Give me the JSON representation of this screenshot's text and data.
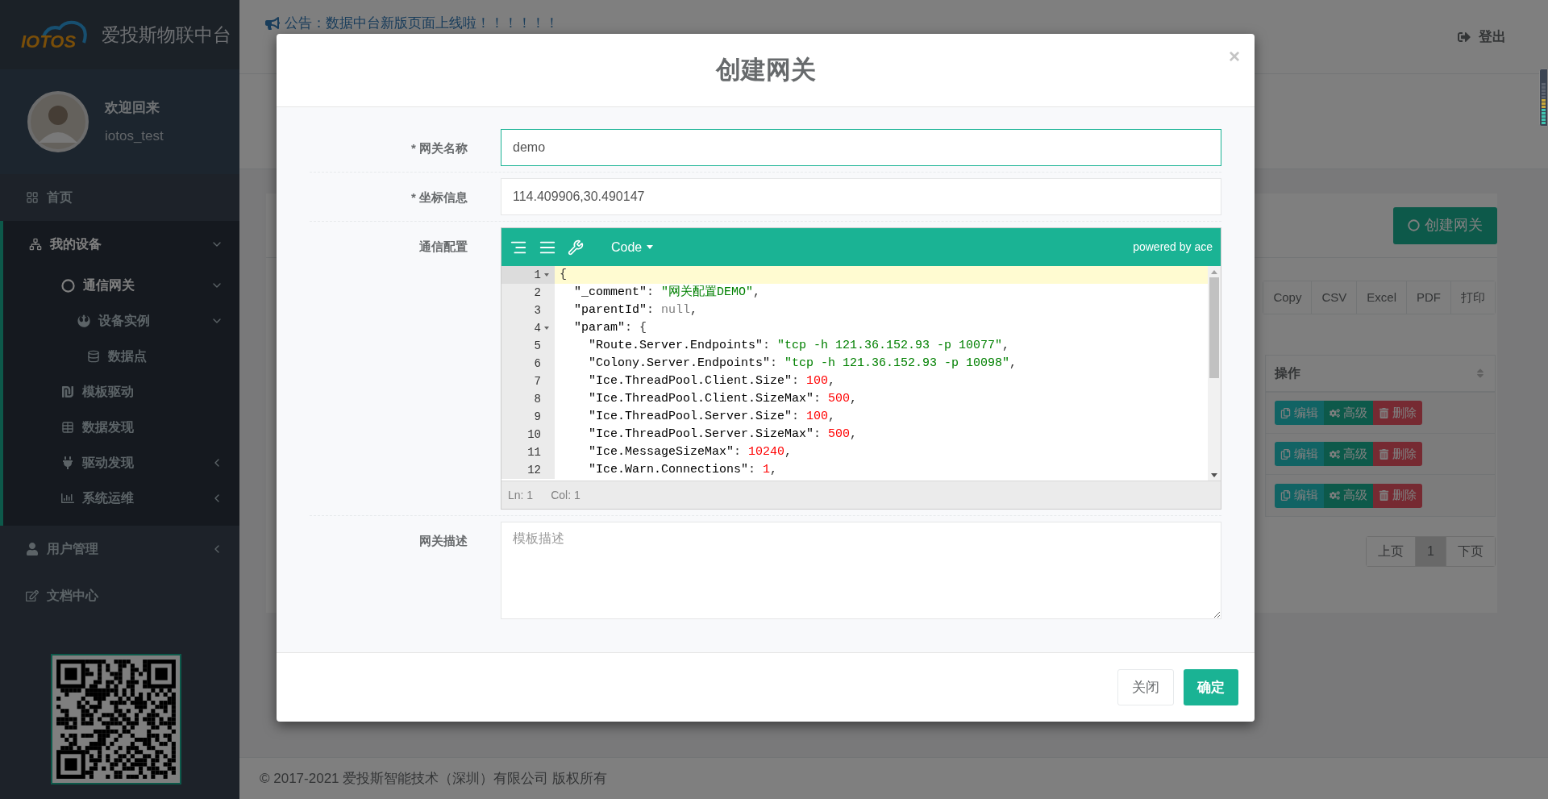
{
  "sidebar": {
    "logo": "IOTOS",
    "title": "爱投斯物联中台",
    "user": {
      "greeting": "欢迎回来",
      "name": "iotos_test"
    },
    "menu": [
      {
        "label": "首页",
        "kind": "link",
        "selected": false
      },
      {
        "label": "我的设备",
        "kind": "group",
        "expanded": true,
        "selected": true,
        "children": [
          {
            "label": "通信网关",
            "kind": "group",
            "expanded": true,
            "selected": true,
            "children": [
              {
                "label": "设备实例",
                "kind": "group",
                "expanded": true,
                "selected": false,
                "children": [
                  {
                    "label": "数据点",
                    "kind": "link",
                    "selected": false
                  }
                ]
              }
            ]
          },
          {
            "label": "模板驱动",
            "kind": "link",
            "selected": false
          },
          {
            "label": "数据发现",
            "kind": "link",
            "selected": false
          },
          {
            "label": "驱动发现",
            "kind": "group",
            "expanded": false,
            "selected": false
          },
          {
            "label": "系统运维",
            "kind": "group",
            "expanded": false,
            "selected": false
          }
        ]
      },
      {
        "label": "用户管理",
        "kind": "group",
        "expanded": false,
        "selected": false
      },
      {
        "label": "文档中心",
        "kind": "link",
        "selected": false
      }
    ]
  },
  "topbar": {
    "announcement": "公告：数据中台新版页面上线啦！！！！！！",
    "logout": "登出"
  },
  "panel": {
    "create_button": "创建网关",
    "export_buttons": [
      "Copy",
      "CSV",
      "Excel",
      "PDF",
      "打印"
    ],
    "table": {
      "columns": [
        {
          "label": "操作"
        }
      ],
      "rows": [
        {
          "actions": [
            {
              "kind": "edit",
              "label": "编辑"
            },
            {
              "kind": "advanced",
              "label": "高级"
            },
            {
              "kind": "delete",
              "label": "删除"
            }
          ]
        },
        {
          "actions": [
            {
              "kind": "edit",
              "label": "编辑"
            },
            {
              "kind": "advanced",
              "label": "高级"
            },
            {
              "kind": "delete",
              "label": "删除"
            }
          ]
        },
        {
          "actions": [
            {
              "kind": "edit",
              "label": "编辑"
            },
            {
              "kind": "advanced",
              "label": "高级"
            },
            {
              "kind": "delete",
              "label": "删除"
            }
          ]
        }
      ]
    },
    "pagination": [
      {
        "label": "上页",
        "selected": false
      },
      {
        "label": "1",
        "selected": true
      },
      {
        "label": "下页",
        "selected": false
      }
    ]
  },
  "footer": "© 2017-2021 爱投斯智能技术（深圳）有限公司 版权所有",
  "modal": {
    "title": "创建网关",
    "close": "×",
    "fields": [
      {
        "kind": "input",
        "label": "* 网关名称",
        "value": "demo",
        "focused": true
      },
      {
        "kind": "input",
        "label": "* 坐标信息",
        "value": "114.409906,30.490147",
        "focused": false
      },
      {
        "kind": "editor",
        "label": "通信配置"
      },
      {
        "kind": "textarea",
        "label": "网关描述",
        "placeholder": "模板描述"
      }
    ],
    "editor": {
      "mode": "Code",
      "brand": "powered by ace",
      "status": [
        "Ln: 1",
        "Col: 1"
      ],
      "lines": [
        {
          "number": "1",
          "foldable": true,
          "selected": true,
          "tokens": [
            {
              "kind": "punct",
              "text": "{"
            }
          ]
        },
        {
          "number": "2",
          "foldable": false,
          "selected": false,
          "tokens": [
            {
              "kind": "key",
              "text": "  \"_comment\""
            },
            {
              "kind": "punct",
              "text": ": "
            },
            {
              "kind": "string",
              "text": "\"网关配置DEMO\""
            },
            {
              "kind": "punct",
              "text": ","
            }
          ]
        },
        {
          "number": "3",
          "foldable": false,
          "selected": false,
          "tokens": [
            {
              "kind": "key",
              "text": "  \"parentId\""
            },
            {
              "kind": "punct",
              "text": ": "
            },
            {
              "kind": "null",
              "text": "null"
            },
            {
              "kind": "punct",
              "text": ","
            }
          ]
        },
        {
          "number": "4",
          "foldable": true,
          "selected": false,
          "tokens": [
            {
              "kind": "key",
              "text": "  \"param\""
            },
            {
              "kind": "punct",
              "text": ": {"
            }
          ]
        },
        {
          "number": "5",
          "foldable": false,
          "selected": false,
          "tokens": [
            {
              "kind": "key",
              "text": "    \"Route.Server.Endpoints\""
            },
            {
              "kind": "punct",
              "text": ": "
            },
            {
              "kind": "string",
              "text": "\"tcp -h 121.36.152.93 -p 10077\""
            },
            {
              "kind": "punct",
              "text": ","
            }
          ]
        },
        {
          "number": "6",
          "foldable": false,
          "selected": false,
          "tokens": [
            {
              "kind": "key",
              "text": "    \"Colony.Server.Endpoints\""
            },
            {
              "kind": "punct",
              "text": ": "
            },
            {
              "kind": "string",
              "text": "\"tcp -h 121.36.152.93 -p 10098\""
            },
            {
              "kind": "punct",
              "text": ","
            }
          ]
        },
        {
          "number": "7",
          "foldable": false,
          "selected": false,
          "tokens": [
            {
              "kind": "key",
              "text": "    \"Ice.ThreadPool.Client.Size\""
            },
            {
              "kind": "punct",
              "text": ": "
            },
            {
              "kind": "number",
              "text": "100"
            },
            {
              "kind": "punct",
              "text": ","
            }
          ]
        },
        {
          "number": "8",
          "foldable": false,
          "selected": false,
          "tokens": [
            {
              "kind": "key",
              "text": "    \"Ice.ThreadPool.Client.SizeMax\""
            },
            {
              "kind": "punct",
              "text": ": "
            },
            {
              "kind": "number",
              "text": "500"
            },
            {
              "kind": "punct",
              "text": ","
            }
          ]
        },
        {
          "number": "9",
          "foldable": false,
          "selected": false,
          "tokens": [
            {
              "kind": "key",
              "text": "    \"Ice.ThreadPool.Server.Size\""
            },
            {
              "kind": "punct",
              "text": ": "
            },
            {
              "kind": "number",
              "text": "100"
            },
            {
              "kind": "punct",
              "text": ","
            }
          ]
        },
        {
          "number": "10",
          "foldable": false,
          "selected": false,
          "tokens": [
            {
              "kind": "key",
              "text": "    \"Ice.ThreadPool.Server.SizeMax\""
            },
            {
              "kind": "punct",
              "text": ": "
            },
            {
              "kind": "number",
              "text": "500"
            },
            {
              "kind": "punct",
              "text": ","
            }
          ]
        },
        {
          "number": "11",
          "foldable": false,
          "selected": false,
          "tokens": [
            {
              "kind": "key",
              "text": "    \"Ice.MessageSizeMax\""
            },
            {
              "kind": "punct",
              "text": ": "
            },
            {
              "kind": "number",
              "text": "10240"
            },
            {
              "kind": "punct",
              "text": ","
            }
          ]
        },
        {
          "number": "12",
          "foldable": false,
          "selected": false,
          "tokens": [
            {
              "kind": "key",
              "text": "    \"Ice.Warn.Connections\""
            },
            {
              "kind": "punct",
              "text": ": "
            },
            {
              "kind": "number",
              "text": "1"
            },
            {
              "kind": "punct",
              "text": ","
            }
          ]
        }
      ]
    },
    "buttons": [
      {
        "kind": "secondary",
        "label": "关闭"
      },
      {
        "kind": "primary",
        "label": "确定"
      }
    ]
  }
}
